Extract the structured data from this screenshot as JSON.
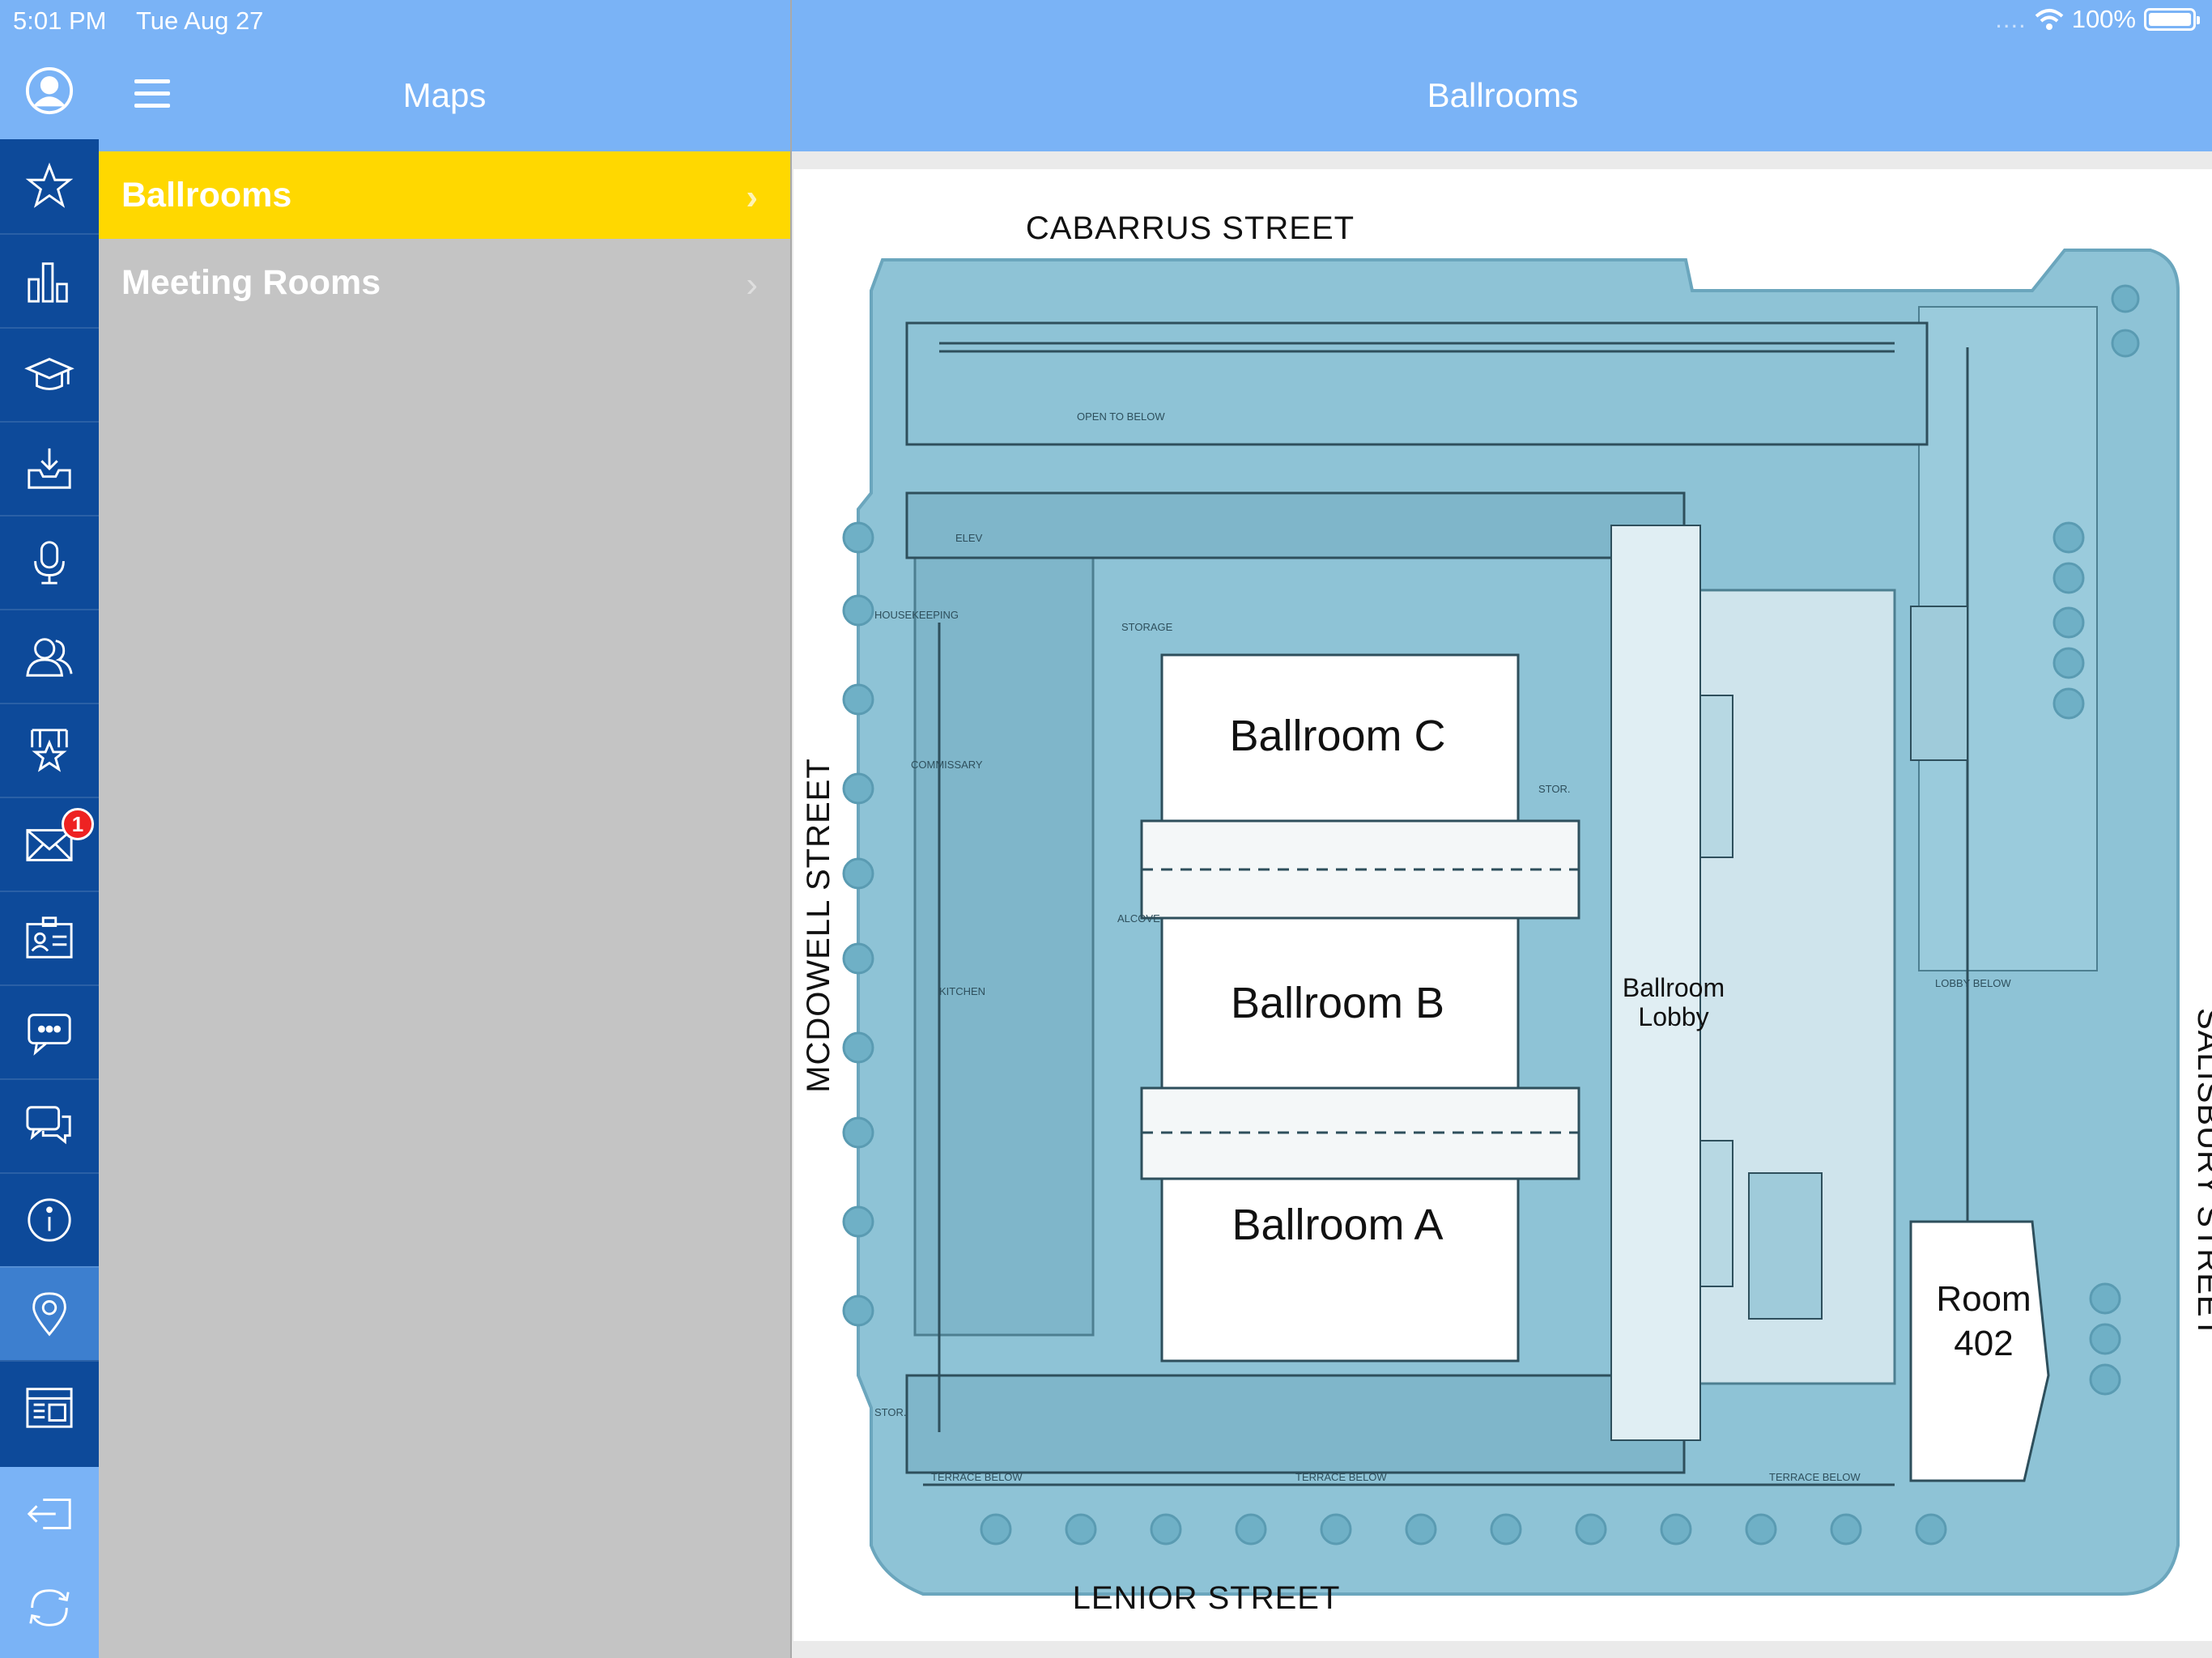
{
  "status_bar": {
    "time": "5:01 PM",
    "date": "Tue Aug 27",
    "signal": "....",
    "battery": "100%"
  },
  "rail": {
    "items": [
      {
        "icon": "user-icon"
      },
      {
        "icon": "star-icon"
      },
      {
        "icon": "bar-chart-icon"
      },
      {
        "icon": "graduation-cap-icon"
      },
      {
        "icon": "inbox-download-icon"
      },
      {
        "icon": "microphone-icon"
      },
      {
        "icon": "people-icon"
      },
      {
        "icon": "award-icon"
      },
      {
        "icon": "mail-icon",
        "badge": "1"
      },
      {
        "icon": "id-card-icon"
      },
      {
        "icon": "chat-bubble-icon"
      },
      {
        "icon": "conversation-icon"
      },
      {
        "icon": "info-icon"
      },
      {
        "icon": "map-pin-icon",
        "active": true
      },
      {
        "icon": "schedule-icon"
      },
      {
        "icon": "logout-icon"
      },
      {
        "icon": "refresh-icon"
      }
    ]
  },
  "list_pane": {
    "title": "Maps",
    "items": [
      {
        "label": "Ballrooms",
        "selected": true
      },
      {
        "label": "Meeting Rooms",
        "selected": false
      }
    ]
  },
  "detail": {
    "title": "Ballrooms",
    "map": {
      "streets": {
        "north": "CABARRUS STREET",
        "west": "MCDOWELL STREET",
        "east": "SALISBURY STREET",
        "south": "LENIOR STREET"
      },
      "rooms": {
        "ballroom_c": "Ballroom C",
        "ballroom_b": "Ballroom B",
        "ballroom_a": "Ballroom A",
        "lobby_line1": "Ballroom",
        "lobby_line2": "Lobby",
        "room_line1": "Room",
        "room_line2": "402"
      },
      "small_labels": {
        "open_below": "OPEN TO BELOW",
        "storage": "STORAGE",
        "commissary": "COMMISSARY",
        "kitchen": "KITCHEN",
        "housekeeping": "HOUSEKEEPING",
        "lobby_below": "LOBBY BELOW",
        "terrace_below": "TERRACE BELOW",
        "stor": "STOR.",
        "alcove": "ALCOVE",
        "elev": "ELEV"
      }
    }
  },
  "colors": {
    "top_bar": "#7ab3f6",
    "rail": "#0d4a9a",
    "selected_row": "#ffd800",
    "list_bg": "#c4c4c4",
    "map_building": "#8ec3d6"
  }
}
